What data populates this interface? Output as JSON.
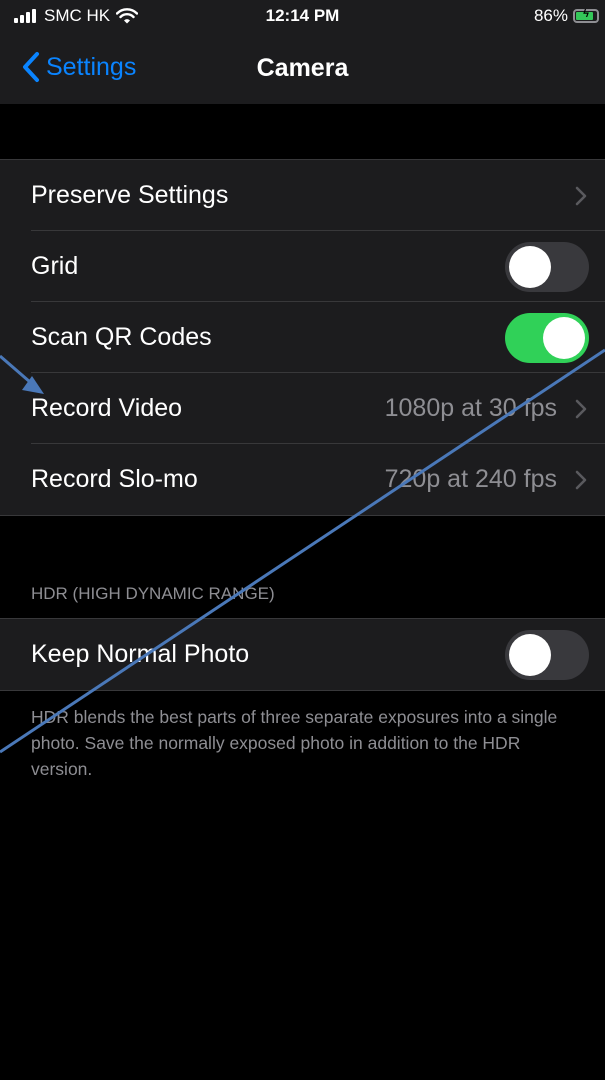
{
  "status_bar": {
    "carrier": "SMC HK",
    "time": "12:14 PM",
    "battery_percent": "86%",
    "battery_level": 0.86,
    "icons": [
      "signal-icon",
      "wifi-icon",
      "battery-charging-icon"
    ]
  },
  "nav": {
    "back_label": "Settings",
    "title": "Camera",
    "back_icon": "chevron-left-icon"
  },
  "group1": {
    "rows": [
      {
        "label": "Preserve Settings",
        "value": "",
        "accessory": "chevron"
      },
      {
        "label": "Grid",
        "accessory": "toggle",
        "on": false
      },
      {
        "label": "Scan QR Codes",
        "accessory": "toggle",
        "on": true
      },
      {
        "label": "Record Video",
        "value": "1080p at 30 fps",
        "accessory": "chevron"
      },
      {
        "label": "Record Slo-mo",
        "value": "720p at 240 fps",
        "accessory": "chevron"
      }
    ]
  },
  "hdr": {
    "header": "HDR (HIGH DYNAMIC RANGE)",
    "row_label": "Keep Normal Photo",
    "row_on": false,
    "footer": "HDR blends the best parts of three separate exposures into a single photo. Save the normally exposed photo in addition to the HDR version."
  },
  "colors": {
    "accent": "#0a84ff",
    "toggle_on": "#30d158",
    "annotation_arrow": "#4a78b8"
  }
}
